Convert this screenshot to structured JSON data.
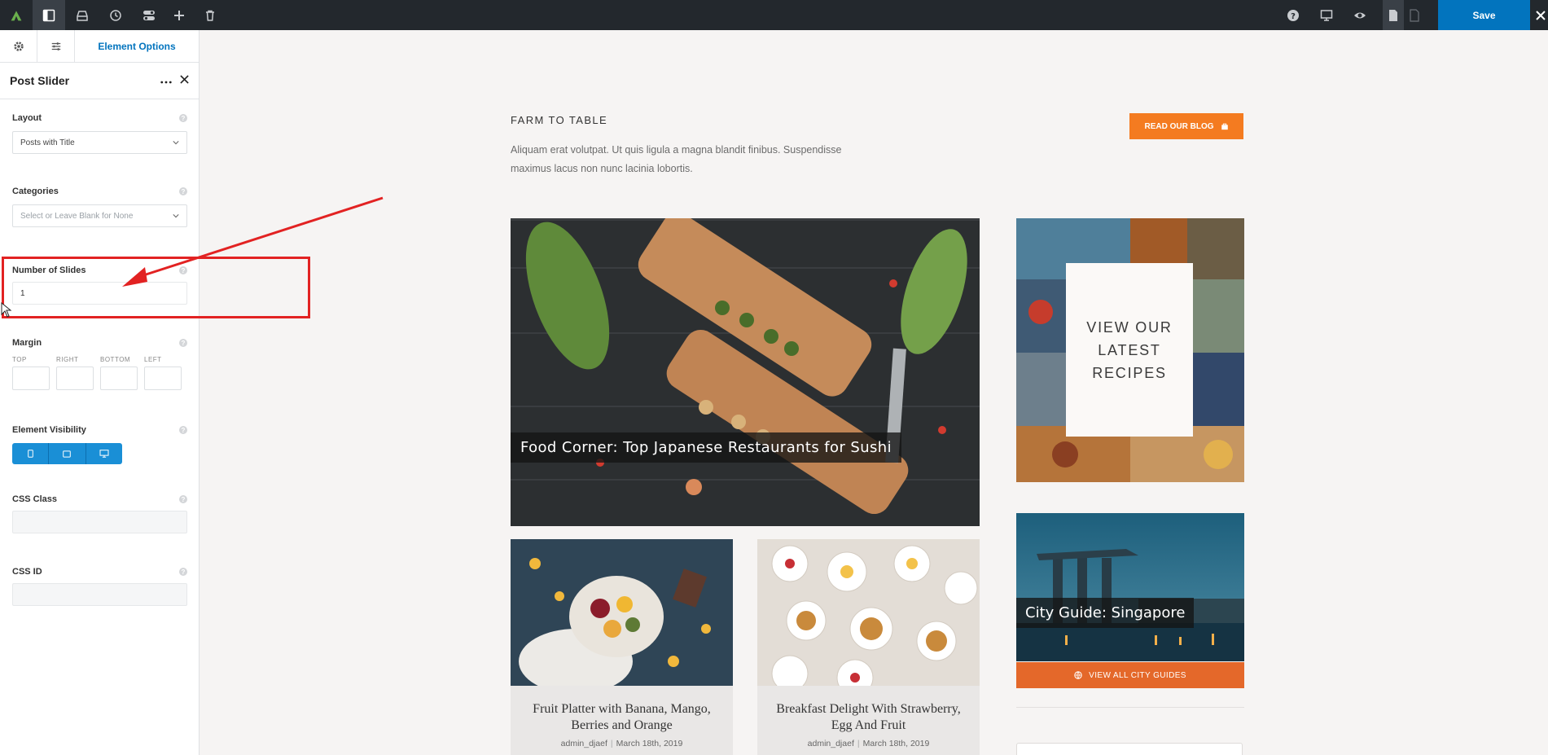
{
  "toolbar": {
    "save_label": "Save",
    "left_icons": [
      "avada-logo-icon",
      "sidebar-toggle-icon",
      "library-icon",
      "history-icon",
      "toggle-icon",
      "plus-icon",
      "trash-icon"
    ],
    "right_icons": [
      "help-icon",
      "desktop-icon",
      "eye-icon",
      "page-icon",
      "page-alt-icon"
    ],
    "accent": "#0274be"
  },
  "panel": {
    "tab_label": "Element Options",
    "title": "Post Slider",
    "layout": {
      "label": "Layout",
      "value": "Posts with Title"
    },
    "categories": {
      "label": "Categories",
      "placeholder": "Select or Leave Blank for None"
    },
    "slides": {
      "label": "Number of Slides",
      "value": "1"
    },
    "margin": {
      "label": "Margin",
      "top": "TOP",
      "right": "RIGHT",
      "bottom": "BOTTOM",
      "left": "LEFT"
    },
    "visibility": {
      "label": "Element Visibility"
    },
    "css_class": {
      "label": "CSS Class",
      "value": ""
    },
    "css_id": {
      "label": "CSS ID",
      "value": ""
    }
  },
  "canvas": {
    "kicker": "FARM TO TABLE",
    "intro": "Aliquam erat volutpat. Ut quis ligula a magna blandit finibus. Suspendisse maximus lacus non nunc lacinia lobortis.",
    "read_button": "READ OUR BLOG",
    "hero_caption": "Food Corner: Top Japanese Restaurants for Sushi",
    "cards": [
      {
        "title": "Fruit Platter with Banana, Mango, Berries and Orange",
        "author": "admin_djaef",
        "date": "March 18th, 2019"
      },
      {
        "title": "Breakfast Delight With Strawberry, Egg And Fruit",
        "author": "admin_djaef",
        "date": "March 18th, 2019"
      }
    ],
    "recipes_text": "VIEW OUR LATEST RECIPES",
    "city_caption": "City Guide: Singapore",
    "city_button": "VIEW ALL CITY GUIDES",
    "accent_orange": "#f47b20"
  }
}
